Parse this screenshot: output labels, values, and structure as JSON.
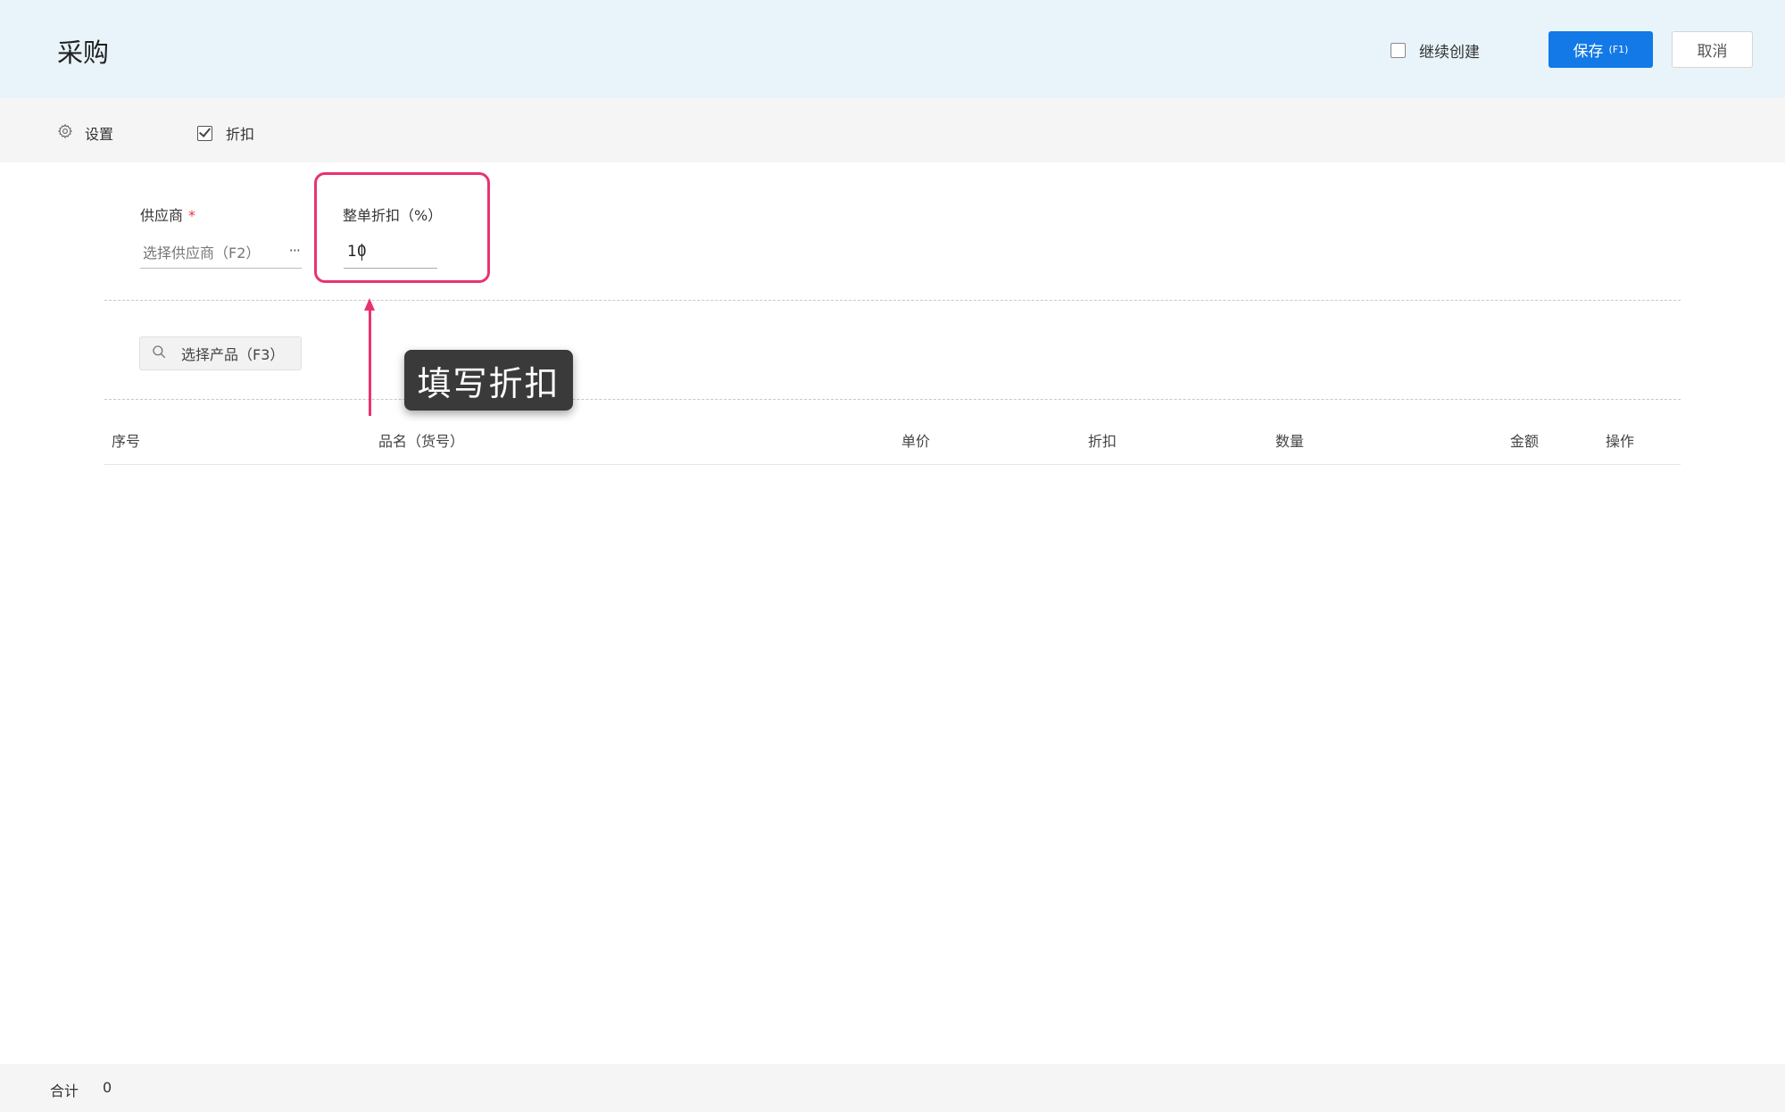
{
  "header": {
    "title": "采购",
    "continue_create_label": "继续创建",
    "continue_create_checked": false,
    "save_label": "保存",
    "save_shortcut": "(F1)",
    "cancel_label": "取消",
    "background_color": "#e8f4fa",
    "accent_color": "#1279e6"
  },
  "toolbar": {
    "settings_icon": "gear-icon",
    "settings_label": "设置",
    "discount_label": "折扣",
    "discount_checked": true
  },
  "form": {
    "supplier_label": "供应商",
    "required_mark": "*",
    "supplier_placeholder": "选择供应商（F2）",
    "supplier_more_icon": "···",
    "total_discount_label": "整单折扣（%）",
    "total_discount_value": "10",
    "highlight_color": "#e8336f"
  },
  "product_search": {
    "icon": "search-icon",
    "placeholder": "选择产品（F3）"
  },
  "annotation": {
    "callout_text": "填写折扣"
  },
  "table": {
    "columns": [
      "序号",
      "品名（货号）",
      "单价",
      "折扣",
      "数量",
      "金额",
      "操作"
    ],
    "rows": []
  },
  "footer": {
    "total_label": "合计",
    "total_value": "0"
  }
}
